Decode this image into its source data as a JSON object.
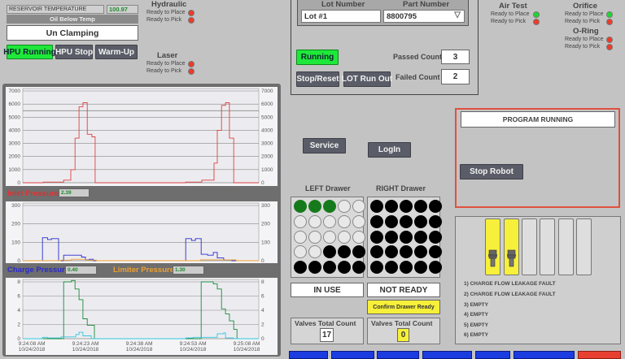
{
  "hpu": {
    "reservoir_label": "RESERVOIR TEMPERATURE",
    "reservoir_value": "100.97",
    "oil_status": "Oil Below Temp",
    "clamp_status": "Un Clamping",
    "hpu_running": "HPU Running",
    "hpu_stop": "HPU Stop",
    "warm_up": "Warm-Up"
  },
  "stations": {
    "hydraulic": {
      "title": "Hydraulic",
      "place": "Ready to Place",
      "pick": "Ready to Pick",
      "place_state": "red",
      "pick_state": "red"
    },
    "laser": {
      "title": "Laser",
      "place": "Ready to Place",
      "pick": "Ready to Pick",
      "place_state": "red",
      "pick_state": "red"
    },
    "air_test": {
      "title": "Air Test",
      "place": "Ready to Place",
      "pick": "Ready to Pick",
      "place_state": "green",
      "pick_state": "red"
    },
    "orifice": {
      "title": "Orifice",
      "place": "Ready to Place",
      "pick": "Ready to Pick",
      "place_state": "green",
      "pick_state": "red"
    },
    "oring": {
      "title": "O-Ring",
      "place": "Ready to Place",
      "pick": "Ready to Pick",
      "place_state": "red",
      "pick_state": "red"
    }
  },
  "lot": {
    "lot_label": "Lot Number",
    "part_label": "Part Number",
    "lot_value": "Lot #1",
    "part_value": "8800795",
    "running": "Running",
    "stop_reset": "Stop/Reset",
    "lot_run_out": "LOT Run Out",
    "passed_label": "Passed Count",
    "passed_value": "3",
    "failed_label": "Failed Count",
    "failed_value": "2"
  },
  "nav": {
    "service": "Service",
    "login": "LogIn"
  },
  "robot": {
    "status": "PROGRAM RUNNING",
    "stop": "Stop Robot"
  },
  "drawers": {
    "left": {
      "title": "LEFT Drawer",
      "status": "IN USE",
      "count_label": "Valves Total Count",
      "count": "17",
      "cells": [
        "g",
        "g",
        "g",
        "e",
        "e",
        "e",
        "e",
        "e",
        "e",
        "e",
        "e",
        "e",
        "e",
        "e",
        "e",
        "e",
        "e",
        "f",
        "f",
        "f",
        "f",
        "f",
        "f",
        "f",
        "f"
      ]
    },
    "right": {
      "title": "RIGHT Drawer",
      "status": "NOT READY",
      "confirm": "Confirm Drawer Ready",
      "count_label": "Valves Total Count",
      "count": "0",
      "cells": [
        "f",
        "f",
        "f",
        "f",
        "f",
        "f",
        "f",
        "f",
        "f",
        "f",
        "f",
        "f",
        "f",
        "f",
        "f",
        "f",
        "f",
        "f",
        "f",
        "f",
        "f",
        "f",
        "f",
        "f",
        "f"
      ]
    }
  },
  "slots": {
    "filled": [
      true,
      true,
      false,
      false,
      false,
      false
    ],
    "faults": [
      "1) CHARGE FLOW LEAKAGE FAULT",
      "2) CHARGE FLOW LEAKAGE FAULT",
      "3) EMPTY",
      "4) EMPTY",
      "5) EMPTY",
      "6) EMPTY"
    ]
  },
  "gauges": {
    "inlet_label": "Inlet Pressure",
    "inlet_value": "2.39",
    "charge_label": "Charge Pressure",
    "charge_value": "0.40",
    "limiter_label": "Limiter Pressure",
    "limiter_value": "1.30"
  },
  "colors": {
    "accent_green": "#1ee83a",
    "fault_red": "#ef3a2a",
    "button": "#5a5d68"
  },
  "chart_data": [
    {
      "type": "line",
      "title": "Inlet Pressure",
      "ylim": [
        0,
        7000
      ],
      "yticks": [
        0,
        1000,
        2000,
        3000,
        4000,
        5000,
        6000,
        7000
      ],
      "x_unit": "seconds after 9:24:00 AM",
      "xlim": [
        6.4,
        72.3
      ],
      "limit_line": 5500,
      "series": [
        {
          "name": "Inlet Pressure",
          "color": "#e04040",
          "points": [
            [
              6.4,
              0
            ],
            [
              12.1,
              50
            ],
            [
              17.8,
              200
            ],
            [
              19.8,
              1000
            ],
            [
              21,
              3400
            ],
            [
              22.1,
              5800
            ],
            [
              23.2,
              6100
            ],
            [
              24.4,
              3700
            ],
            [
              25.7,
              3500
            ],
            [
              26.6,
              0
            ],
            [
              51.9,
              50
            ],
            [
              56.4,
              200
            ],
            [
              59.8,
              1500
            ],
            [
              60.7,
              4000
            ],
            [
              61.9,
              5900
            ],
            [
              63,
              6100
            ],
            [
              64.1,
              3400
            ],
            [
              65.3,
              0
            ],
            [
              72.3,
              0
            ]
          ]
        }
      ]
    },
    {
      "type": "line",
      "title": "Charge / Limiter Pressure",
      "ylim": [
        0,
        300
      ],
      "yticks": [
        0,
        100,
        200,
        300
      ],
      "xlim": [
        6.4,
        72.3
      ],
      "series": [
        {
          "name": "Charge Pressure",
          "color": "#2a2ad0",
          "points": [
            [
              6.4,
              0
            ],
            [
              11.9,
              125
            ],
            [
              13.3,
              115
            ],
            [
              14.4,
              120
            ],
            [
              16.4,
              0
            ],
            [
              17.8,
              30
            ],
            [
              21,
              30
            ],
            [
              22.8,
              20
            ],
            [
              23.9,
              5
            ],
            [
              25,
              8
            ],
            [
              26.1,
              0
            ],
            [
              51.9,
              120
            ],
            [
              53.5,
              110
            ],
            [
              54.6,
              120
            ],
            [
              56.2,
              35
            ],
            [
              58,
              30
            ],
            [
              59.6,
              45
            ],
            [
              60.7,
              15
            ],
            [
              62.5,
              5
            ],
            [
              64.8,
              0
            ],
            [
              72.3,
              0
            ]
          ]
        },
        {
          "name": "Limiter Pressure",
          "color": "#f0a030",
          "points": [
            [
              6.4,
              0
            ],
            [
              17,
              3
            ],
            [
              20,
              8
            ],
            [
              24,
              3
            ],
            [
              27,
              0
            ],
            [
              52,
              0
            ],
            [
              56,
              5
            ],
            [
              64,
              5
            ],
            [
              66,
              0
            ],
            [
              72.3,
              0
            ]
          ]
        }
      ]
    },
    {
      "type": "line",
      "title": "Flow",
      "ylim": [
        0,
        8
      ],
      "yticks": [
        0,
        2,
        4,
        6,
        8
      ],
      "xlim": [
        6.4,
        72.3
      ],
      "xticks": [
        {
          "t": 8,
          "label": [
            "9:24:08 AM",
            "10/24/2018"
          ]
        },
        {
          "t": 23,
          "label": [
            "9:24:23 AM",
            "10/24/2018"
          ]
        },
        {
          "t": 38,
          "label": [
            "9:24:38 AM",
            "10/24/2018"
          ]
        },
        {
          "t": 53,
          "label": [
            "9:24:53 AM",
            "10/24/2018"
          ]
        },
        {
          "t": 68,
          "label": [
            "9:25:08 AM",
            "10/24/2018"
          ]
        }
      ],
      "series": [
        {
          "name": "Green",
          "color": "#1a8a3a",
          "points": [
            [
              6.4,
              0
            ],
            [
              17.8,
              8
            ],
            [
              20,
              8.2
            ],
            [
              21,
              7
            ],
            [
              22.1,
              5.5
            ],
            [
              23.2,
              2.8
            ],
            [
              24.4,
              1.9
            ],
            [
              26.4,
              0
            ],
            [
              56.2,
              8
            ],
            [
              59.6,
              7.7
            ],
            [
              60.7,
              7
            ],
            [
              61.9,
              4.2
            ],
            [
              63,
              3.5
            ],
            [
              64.1,
              2.5
            ],
            [
              65.3,
              1.3
            ],
            [
              66.2,
              0
            ],
            [
              72.3,
              0
            ]
          ]
        },
        {
          "name": "Cyan",
          "color": "#30c8e0",
          "points": [
            [
              6.4,
              0
            ],
            [
              11.9,
              0.2
            ],
            [
              13.3,
              0.1
            ],
            [
              17.1,
              0.25
            ],
            [
              21.2,
              0.6
            ],
            [
              22.1,
              0.9
            ],
            [
              23.2,
              0.4
            ],
            [
              25.5,
              0
            ],
            [
              51.9,
              0.1
            ],
            [
              54,
              0.2
            ],
            [
              60.7,
              0.7
            ],
            [
              62.5,
              0.8
            ],
            [
              63,
              0.1
            ],
            [
              65.3,
              0
            ],
            [
              72.3,
              0
            ]
          ]
        }
      ]
    }
  ]
}
